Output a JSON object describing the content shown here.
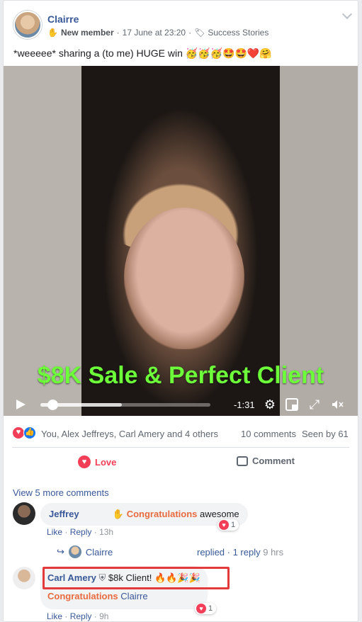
{
  "post": {
    "author": "Clairre",
    "member_badge": "New member",
    "date": "17 June at 23:20",
    "topic": "Success Stories",
    "text": "*weeeee* sharing a (to me) HUGE win 🥳🥳🥳🤩🤩❤️🤗"
  },
  "video": {
    "overlay_title": "$8K Sale & Perfect Client",
    "time_remaining": "-1:31",
    "progress": 0.07,
    "buffered": 0.48
  },
  "stats": {
    "reacted_by": "You, Alex Jeffreys, Carl Amery and 4 others",
    "comments_count": "10 comments",
    "seen_by": "Seen by 61"
  },
  "actions": {
    "love": "Love",
    "comment": "Comment"
  },
  "comments": {
    "view_more": "View 5 more comments",
    "first": {
      "author": "Jeffrey",
      "mention": "Congratulations",
      "text": "awesome",
      "like": "Like",
      "reply": "Reply",
      "time": "13h",
      "reactions": "1",
      "reply_author": "Clairre",
      "replied": "replied · 1 reply",
      "replied_time": "9 hrs"
    },
    "second": {
      "author": "Carl Amery",
      "text": "$8k Client! 🔥🔥🎉🎉",
      "mention": "Congratulations",
      "mention_name": "Clairre",
      "like": "Like",
      "reply": "Reply",
      "time": "9h",
      "reactions": "1"
    }
  },
  "colors": {
    "link": "#385898",
    "love": "#f33e58",
    "mention": "#e86b3f",
    "overlay_text": "#6cff3a",
    "highlight": "#e33b3b"
  }
}
